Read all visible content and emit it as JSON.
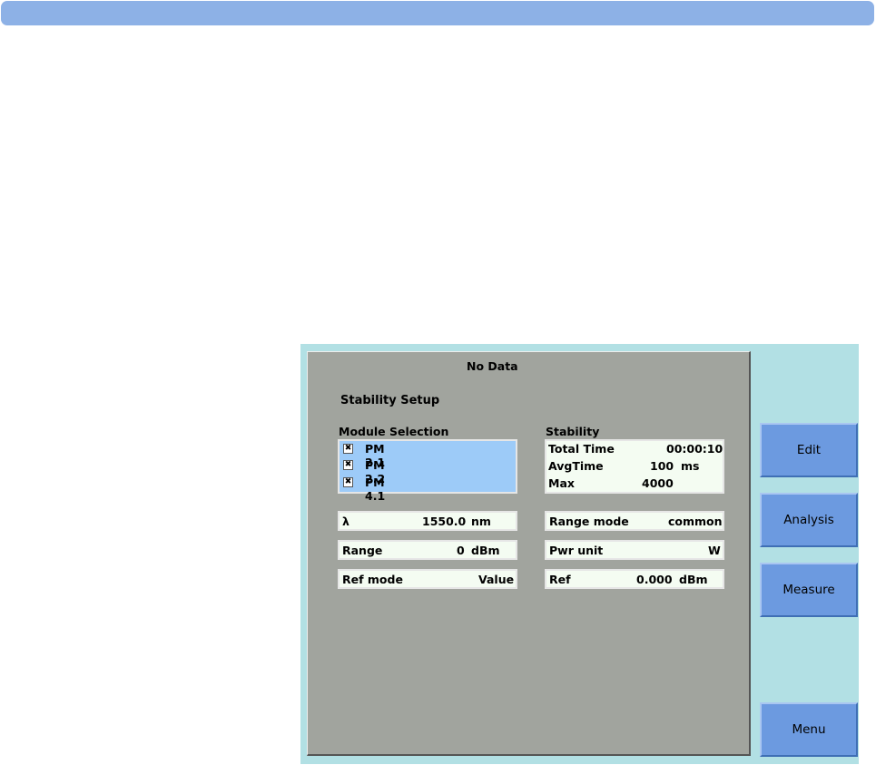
{
  "screen": {
    "status": "No Data",
    "title": "Stability Setup"
  },
  "module_selection": {
    "title": "Module Selection",
    "items": [
      {
        "label": "PM 2.1",
        "checked": true,
        "mark": "✖"
      },
      {
        "label": "PM 2.2",
        "checked": true,
        "mark": "✖"
      },
      {
        "label": "PM 4.1",
        "checked": true,
        "mark": "✖"
      }
    ]
  },
  "stability": {
    "title": "Stability",
    "total_time_label": "Total Time",
    "total_time_value": "00:00:10",
    "avg_time_label": "AvgTime",
    "avg_time_value": "100",
    "avg_time_unit": "ms",
    "max_label": "Max",
    "max_value": "4000"
  },
  "params": {
    "wavelength_label": "λ",
    "wavelength_value": "1550.0",
    "wavelength_unit": "nm",
    "range_label": "Range",
    "range_value": "0",
    "range_unit": "dBm",
    "ref_mode_label": "Ref mode",
    "ref_mode_value": "Value",
    "range_mode_label": "Range mode",
    "range_mode_value": "common",
    "pwr_unit_label": "Pwr unit",
    "pwr_unit_value": "W",
    "ref_label": "Ref",
    "ref_value": "0.000",
    "ref_unit": "dBm"
  },
  "softkeys": {
    "edit": "Edit",
    "analysis": "Analysis",
    "measure": "Measure",
    "menu": "Menu"
  },
  "colors": {
    "top_bar": "#8db1e6",
    "instrument_bg": "#b2e0e4",
    "screen_bg": "#a1a49e",
    "list_selected_bg": "#9dcbf8",
    "softkey": "#6c9ae0"
  }
}
